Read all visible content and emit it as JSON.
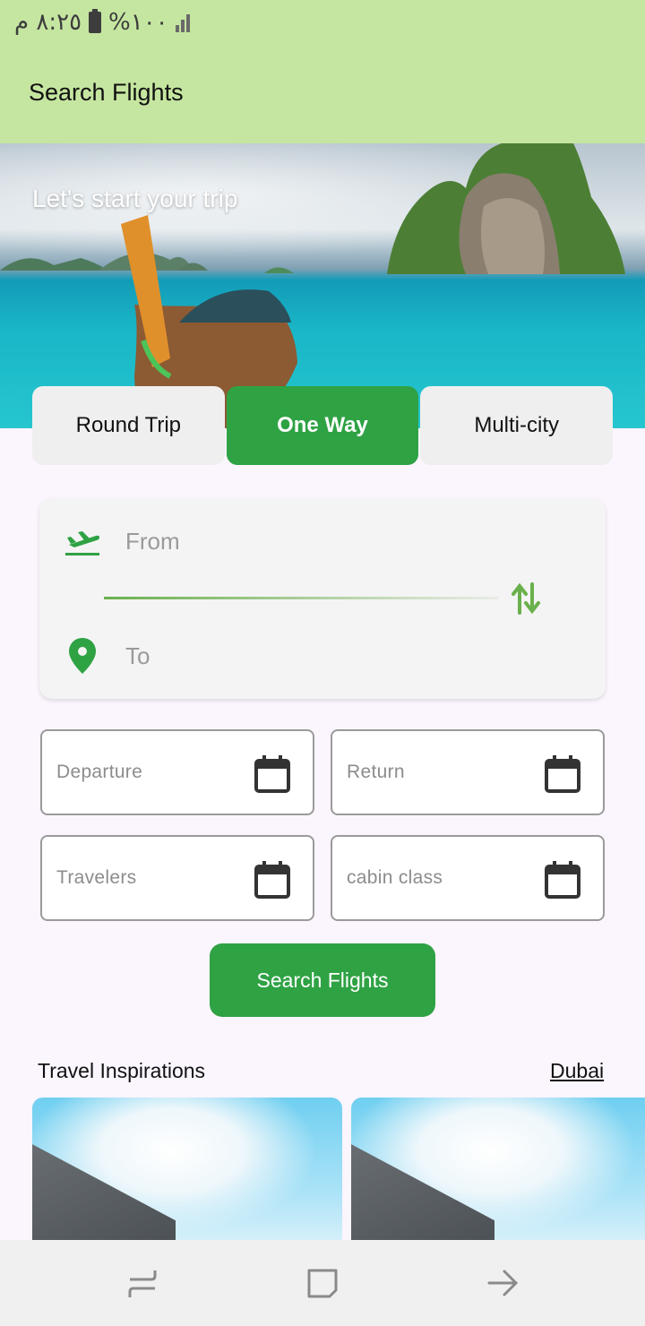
{
  "status_bar": {
    "time": "٨:٢٥ م",
    "battery": "%١٠٠"
  },
  "app_bar": {
    "title": "Search Flights"
  },
  "hero": {
    "title": "Let's start your trip"
  },
  "trip_tabs": [
    {
      "label": "Round Trip",
      "active": false
    },
    {
      "label": "One Way",
      "active": true
    },
    {
      "label": "Multi-city",
      "active": false
    }
  ],
  "route": {
    "from_placeholder": "From",
    "to_placeholder": "To"
  },
  "fields": {
    "departure": "Departure",
    "return": "Return",
    "travelers": "Travelers",
    "cabin_class": "cabin class"
  },
  "search_button": "Search Flights",
  "inspirations": {
    "title": "Travel Inspirations",
    "city": "Dubai"
  },
  "colors": {
    "accent": "#2fa244",
    "app_bar": "#c5e6a0",
    "background": "#fbf5fd"
  },
  "icons": {
    "from": "flight-takeoff-icon",
    "to": "location-pin-icon",
    "swap": "swap-vertical-icon",
    "date": "calendar-icon",
    "nav": [
      "recent-apps-icon",
      "home-icon",
      "back-icon"
    ]
  }
}
